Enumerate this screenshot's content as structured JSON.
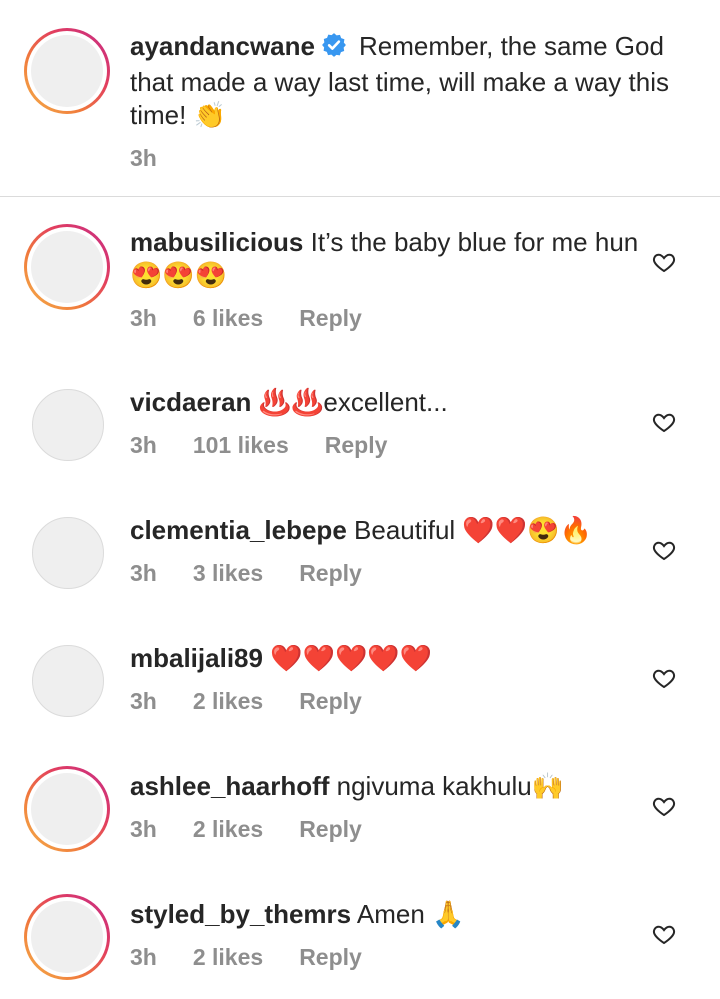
{
  "caption": {
    "username": "ayandancwane",
    "verified": true,
    "text": "Remember, the same God that made a way last time, will make a way this time! 👏",
    "time": "3h"
  },
  "comments": [
    {
      "username": "mabusilicious",
      "text": "It’s the baby blue for me hun 😍😍😍",
      "time": "3h",
      "likes": "6 likes",
      "reply": "Reply",
      "story_ring": true
    },
    {
      "username": "vicdaeran",
      "text": "♨️♨️excellent...",
      "time": "3h",
      "likes": "101 likes",
      "reply": "Reply",
      "story_ring": false
    },
    {
      "username": "clementia_lebepe",
      "text": "Beautiful ❤️❤️😍🔥",
      "time": "3h",
      "likes": "3 likes",
      "reply": "Reply",
      "story_ring": false
    },
    {
      "username": "mbalijali89",
      "text": "❤️❤️❤️❤️❤️",
      "time": "3h",
      "likes": "2 likes",
      "reply": "Reply",
      "story_ring": false
    },
    {
      "username": "ashlee_haarhoff",
      "text": "ngivuma kakhulu🙌",
      "time": "3h",
      "likes": "2 likes",
      "reply": "Reply",
      "story_ring": true
    },
    {
      "username": "styled_by_themrs",
      "text": "Amen 🙏",
      "time": "3h",
      "likes": "2 likes",
      "reply": "Reply",
      "story_ring": true
    }
  ],
  "icons": {
    "verified": "verified-badge-icon",
    "like": "heart-outline-icon"
  },
  "colors": {
    "verified_blue": "#3897f0",
    "meta_gray": "#8e8e8e",
    "text": "#262626"
  }
}
